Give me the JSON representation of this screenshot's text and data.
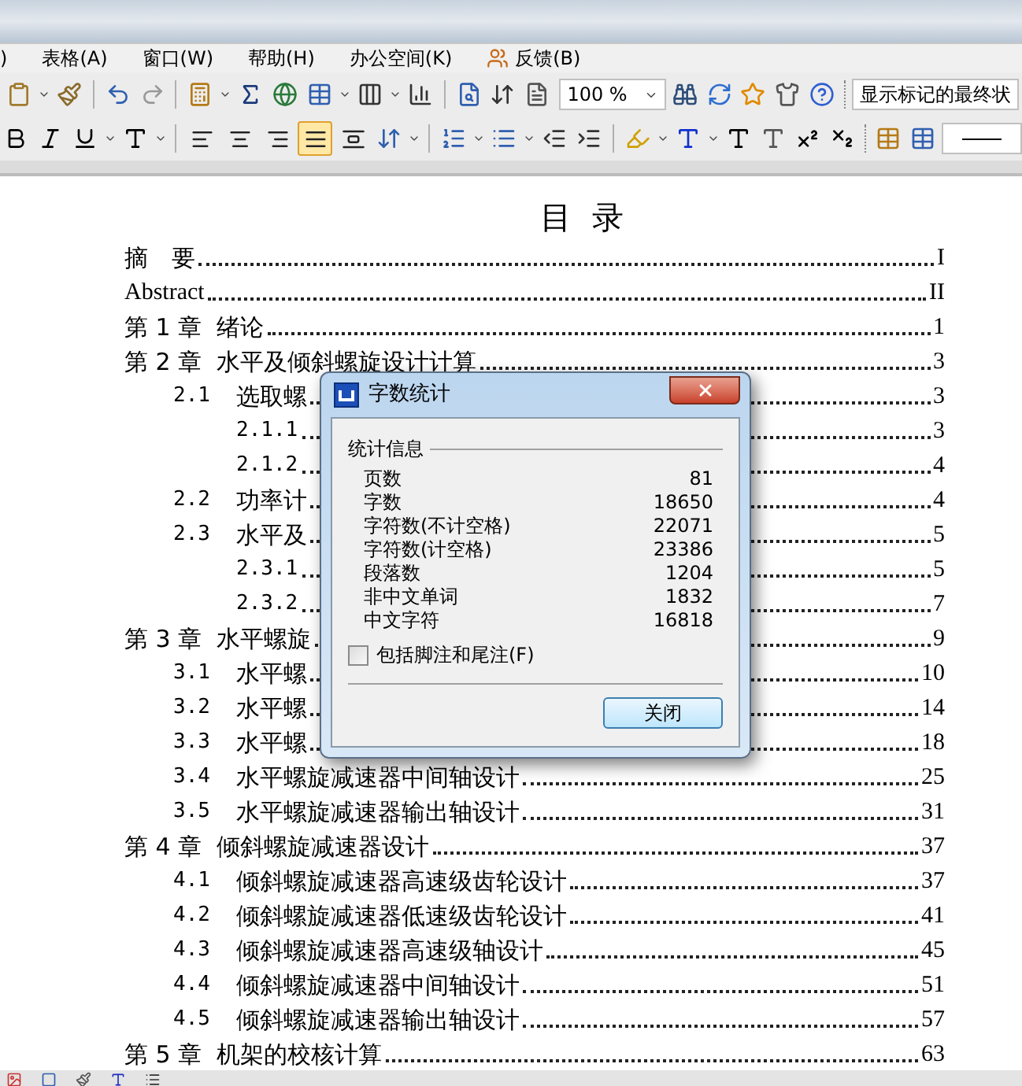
{
  "menu": [
    {
      "label": ")"
    },
    {
      "label": "表格(A)"
    },
    {
      "label": "窗口(W)"
    },
    {
      "label": "帮助(H)"
    },
    {
      "label": "办公空间(K)"
    },
    {
      "label": "反馈(B)",
      "kind": "feedback"
    }
  ],
  "toolbar": {
    "zoom": "100 %",
    "markup": "显示标记的最终状"
  },
  "format_toolbar": {
    "alignment": [
      {
        "selected": false
      },
      {
        "selected": false
      },
      {
        "selected": false
      },
      {
        "selected": true
      },
      {
        "selected": false
      }
    ]
  },
  "document": {
    "title": "目  录",
    "toc": [
      {
        "text": "摘　要",
        "page": "I"
      },
      {
        "text": "Abstract",
        "page": "II",
        "kind": "latin"
      },
      {
        "text": "第 1 章  绪论",
        "page": "1"
      },
      {
        "text": "第 2 章  水平及倾斜螺旋设计计算",
        "page": "3",
        "children": [
          {
            "number": "2.1",
            "title": "选取螺",
            "page": "3",
            "children": [
              {
                "number": "2.1.1",
                "page": "3"
              },
              {
                "number": "2.1.2",
                "page": "4"
              }
            ]
          },
          {
            "number": "2.2",
            "title": "功率计",
            "page": "4"
          },
          {
            "number": "2.3",
            "title": "水平及",
            "page": "5",
            "children": [
              {
                "number": "2.3.1",
                "page": "5"
              },
              {
                "number": "2.3.2",
                "page": "7"
              }
            ]
          }
        ]
      },
      {
        "text": "第 3 章  水平螺旋",
        "page": "9",
        "children": [
          {
            "number": "3.1",
            "title": "水平螺",
            "page": "10"
          },
          {
            "number": "3.2",
            "title": "水平螺",
            "page": "14"
          },
          {
            "number": "3.3",
            "title": "水平螺",
            "page": "18"
          },
          {
            "number": "3.4",
            "title": "水平螺旋减速器中间轴设计",
            "page": "25"
          },
          {
            "number": "3.5",
            "title": "水平螺旋减速器输出轴设计",
            "page": "31"
          }
        ]
      },
      {
        "text": "第 4 章  倾斜螺旋减速器设计",
        "page": "37",
        "children": [
          {
            "number": "4.1",
            "title": "倾斜螺旋减速器高速级齿轮设计",
            "page": "37"
          },
          {
            "number": "4.2",
            "title": "倾斜螺旋减速器低速级齿轮设计",
            "page": "41"
          },
          {
            "number": "4.3",
            "title": "倾斜螺旋减速器高速级轴设计",
            "page": "45"
          },
          {
            "number": "4.4",
            "title": "倾斜螺旋减速器中间轴设计",
            "page": "51"
          },
          {
            "number": "4.5",
            "title": "倾斜螺旋减速器输出轴设计",
            "page": "57"
          }
        ]
      },
      {
        "text": "第 5 章  机架的校核计算",
        "page": "63"
      }
    ]
  },
  "dialog": {
    "title": "字数统计",
    "group": "统计信息",
    "stats": [
      {
        "label": "页数",
        "value": "81"
      },
      {
        "label": "字数",
        "value": "18650"
      },
      {
        "label": "字符数(不计空格)",
        "value": "22071"
      },
      {
        "label": "字符数(计空格)",
        "value": "23386"
      },
      {
        "label": "段落数",
        "value": "1204"
      },
      {
        "label": "非中文单词",
        "value": "1832"
      },
      {
        "label": "中文字符",
        "value": "16818"
      }
    ],
    "checkbox": {
      "label": "包括脚注和尾注(F)",
      "checked": false
    },
    "button": "关闭"
  }
}
